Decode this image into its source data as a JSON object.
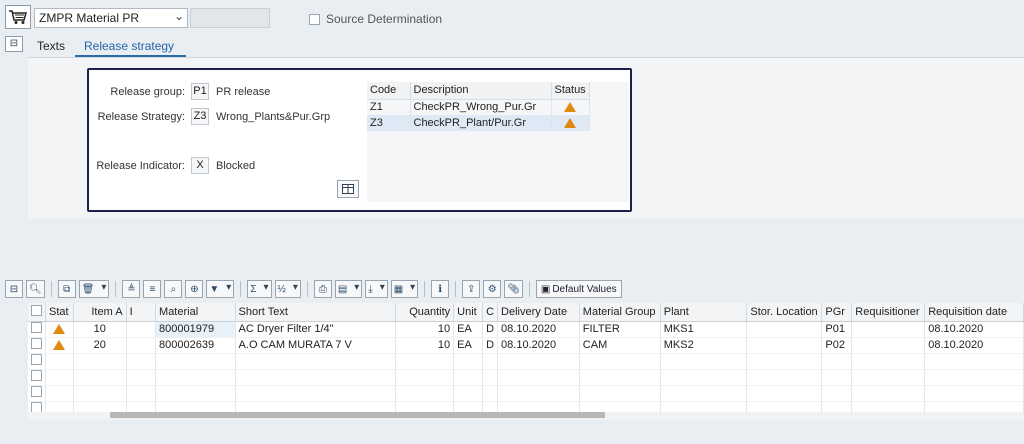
{
  "header": {
    "document_type": "ZMPR Material PR",
    "source_determination_label": "Source Determination",
    "source_determination_checked": false
  },
  "tabs": [
    {
      "label": "Texts",
      "active": false
    },
    {
      "label": "Release strategy",
      "active": true
    }
  ],
  "release": {
    "group_label": "Release group:",
    "group_code": "P1",
    "group_text": "PR release",
    "strategy_label": "Release Strategy:",
    "strategy_code": "Z3",
    "strategy_text": "Wrong_Plants&Pur.Grp",
    "indicator_label": "Release Indicator:",
    "indicator_code": "X",
    "indicator_text": "Blocked",
    "table_headers": {
      "code": "Code",
      "description": "Description",
      "status": "Status"
    },
    "rows": [
      {
        "code": "Z1",
        "description": "CheckPR_Wrong_Pur.Gr",
        "status": "warning-triangle-icon"
      },
      {
        "code": "Z3",
        "description": "CheckPR_Plant/Pur.Gr",
        "status": "warning-triangle-icon"
      }
    ]
  },
  "toolbar": {
    "default_values_label": "Default Values"
  },
  "grid": {
    "headers": {
      "stat": "Stat",
      "item": "Item A",
      "i": "I",
      "material": "Material",
      "short_text": "Short Text",
      "quantity": "Quantity",
      "unit": "Unit",
      "c": "C",
      "delivery_date": "Delivery Date",
      "material_group": "Material Group",
      "plant": "Plant",
      "stor_location": "Stor. Location",
      "pgr": "PGr",
      "requisitioner": "Requisitioner",
      "requisition_date": "Requisition date"
    },
    "rows": [
      {
        "item": "10",
        "material": "800001979",
        "short_text": "AC Dryer Filter 1/4\"",
        "quantity": "10",
        "unit": "EA",
        "c": "D",
        "delivery_date": "08.10.2020",
        "material_group": "FILTER",
        "plant": "MKS1",
        "pgr": "P01",
        "requisition_date": "08.10.2020"
      },
      {
        "item": "20",
        "material": "800002639",
        "short_text": "A.O CAM MURATA 7 V",
        "quantity": "10",
        "unit": "EA",
        "c": "D",
        "delivery_date": "08.10.2020",
        "material_group": "CAM",
        "plant": "MKS2",
        "pgr": "P02",
        "requisition_date": "08.10.2020"
      }
    ]
  },
  "colors": {
    "accent": "#2d6aa8",
    "warning": "#e08a10",
    "frame": "#1d1f4f"
  }
}
